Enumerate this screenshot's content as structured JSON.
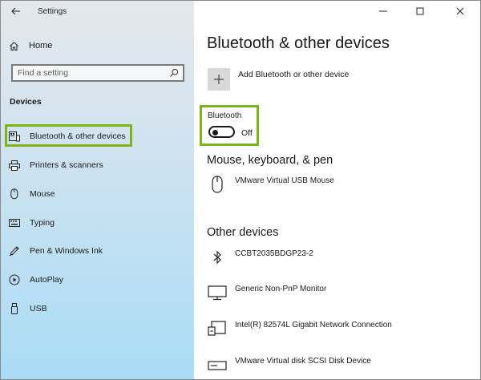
{
  "app": {
    "title": "Settings"
  },
  "sidebar": {
    "home_label": "Home",
    "search_placeholder": "Find a setting",
    "section_label": "Devices",
    "items": [
      {
        "label": "Bluetooth & other devices",
        "icon": "bluetooth-devices-icon",
        "selected": true
      },
      {
        "label": "Printers & scanners",
        "icon": "printer-icon"
      },
      {
        "label": "Mouse",
        "icon": "mouse-icon"
      },
      {
        "label": "Typing",
        "icon": "keyboard-icon"
      },
      {
        "label": "Pen & Windows Ink",
        "icon": "pen-icon"
      },
      {
        "label": "AutoPlay",
        "icon": "autoplay-icon"
      },
      {
        "label": "USB",
        "icon": "usb-icon"
      }
    ]
  },
  "main": {
    "title": "Bluetooth & other devices",
    "add_device_label": "Add Bluetooth or other device",
    "bluetooth": {
      "label": "Bluetooth",
      "state_text": "Off",
      "on": false
    },
    "mouse_section": {
      "heading": "Mouse, keyboard, & pen",
      "devices": [
        {
          "name": "VMware Virtual USB Mouse",
          "icon": "mouse-icon"
        }
      ]
    },
    "other_section": {
      "heading": "Other devices",
      "devices": [
        {
          "name": "CCBT2035BDGP23-2",
          "icon": "bluetooth-icon"
        },
        {
          "name": "Generic Non-PnP Monitor",
          "icon": "monitor-icon"
        },
        {
          "name": "Intel(R) 82574L Gigabit Network Connection",
          "icon": "network-adapter-icon"
        },
        {
          "name": "VMware Virtual disk SCSI Disk Device",
          "icon": "disk-drive-icon"
        }
      ]
    }
  },
  "colors": {
    "highlight": "#7cb518",
    "accent": "#1a1a1a"
  }
}
